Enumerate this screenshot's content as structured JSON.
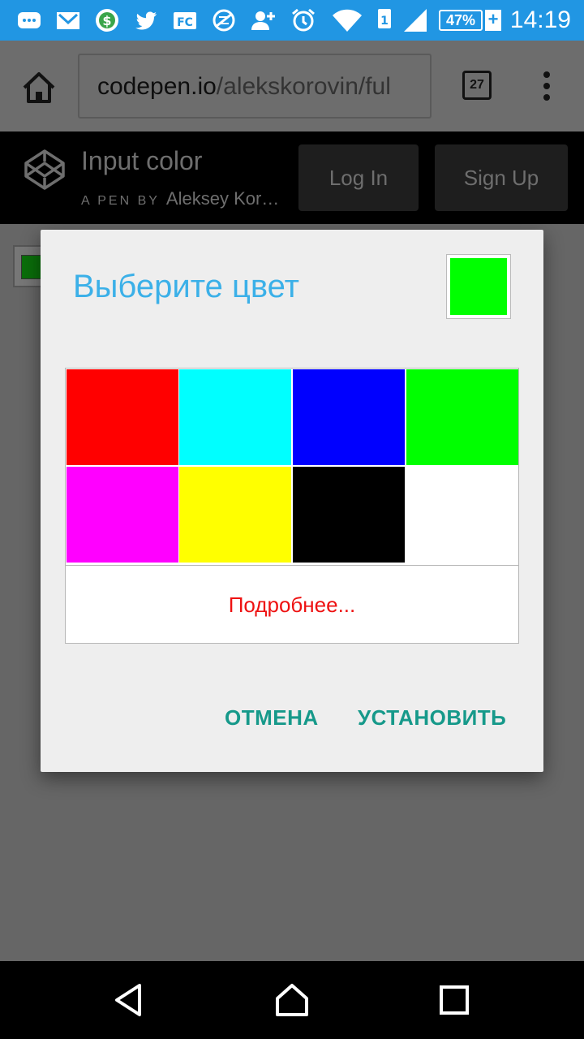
{
  "status_bar": {
    "time": "14:19",
    "battery": "47%",
    "icons": [
      "messages-icon",
      "gmail-icon",
      "money-icon",
      "twitter-icon",
      "feedly-icon",
      "vpn-icon",
      "add-contact-icon",
      "alarm-icon",
      "wifi-icon",
      "sim1-icon",
      "signal-icon",
      "battery-icon"
    ]
  },
  "browser": {
    "url_host": "codepen.io",
    "url_path": "/alekskorovin/ful",
    "tab_count": "27"
  },
  "codepen": {
    "title": "Input color",
    "pen_by": "A PEN BY",
    "author": "Aleksey Kor…",
    "login_label": "Log In",
    "signup_label": "Sign Up"
  },
  "dialog": {
    "title": "Выберите цвет",
    "selected_color": "#00ff00",
    "colors": [
      "#ff0000",
      "#00ffff",
      "#0000ff",
      "#00ff00",
      "#ff00ff",
      "#ffff00",
      "#000000",
      "#ffffff"
    ],
    "more_label": "Подробнее...",
    "cancel_label": "ОТМЕНА",
    "set_label": "УСТАНОВИТЬ"
  },
  "page": {
    "input_color": "#0a6e0a"
  }
}
